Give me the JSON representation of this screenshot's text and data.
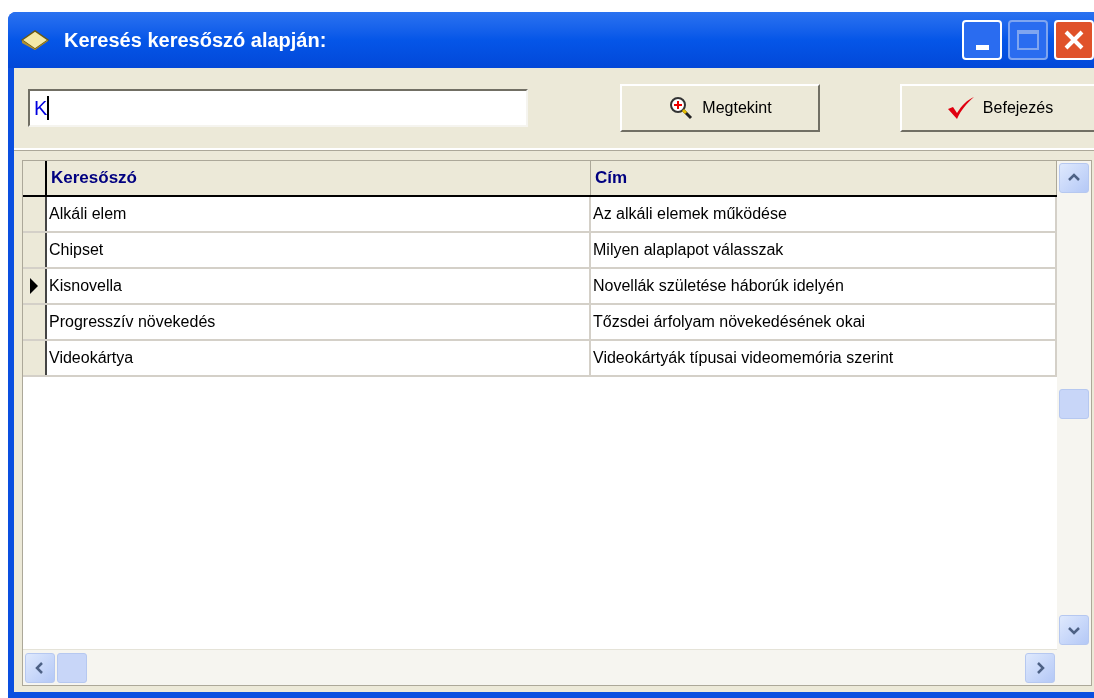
{
  "window": {
    "title": "Keresés keresőszó alapján:"
  },
  "search": {
    "value": "K"
  },
  "buttons": [
    {
      "kind": "view",
      "label": "Megtekint"
    },
    {
      "kind": "finish",
      "label": "Befejezés"
    }
  ],
  "table": {
    "columns": [
      "Keresőszó",
      "Cím"
    ],
    "rows": [
      {
        "cells": [
          "Alkáli elem",
          "Az alkáli elemek működése"
        ],
        "selected": false
      },
      {
        "cells": [
          "Chipset",
          "Milyen alaplapot válasszak"
        ],
        "selected": false
      },
      {
        "cells": [
          "Kisnovella",
          "Novellák születése háborúk idelyén"
        ],
        "selected": true
      },
      {
        "cells": [
          "Progresszív növekedés",
          "Tőzsdei árfolyam növekedésének okai"
        ],
        "selected": false
      },
      {
        "cells": [
          "Videokártya",
          "Videokártyák típusai videomemória szerint"
        ],
        "selected": false
      }
    ]
  }
}
